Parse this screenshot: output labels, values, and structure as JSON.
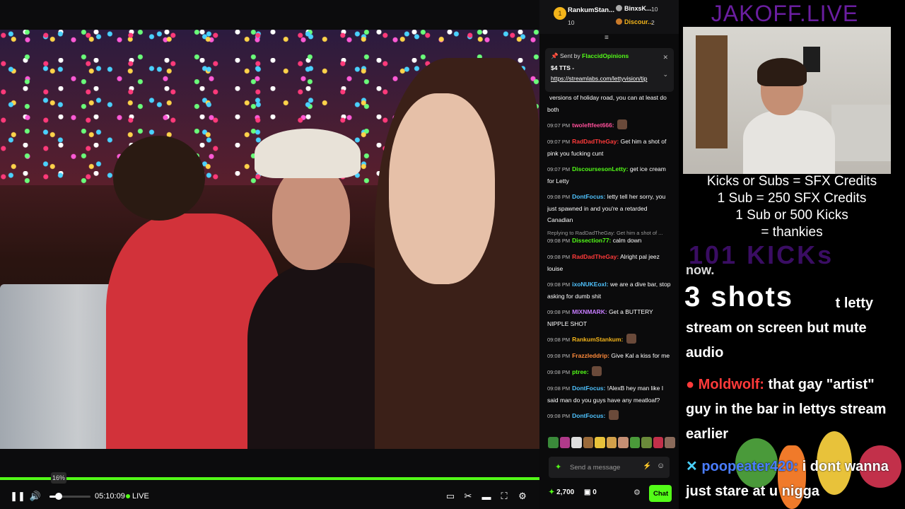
{
  "player": {
    "time": "05:10:09",
    "live_label": "LIVE",
    "volume_tooltip": "16%",
    "volume_percent": 16
  },
  "leaderboard": {
    "first": {
      "rank": "1",
      "name": "RankumStan...",
      "count": "10"
    },
    "second": {
      "name": "BinxsK...",
      "count": "10"
    },
    "third": {
      "name": "Discour...",
      "count": "2"
    }
  },
  "pinned": {
    "sent_by_label": "Sent by",
    "sender": "FlaccidOpinions",
    "amount": "$4 TTS -",
    "link": "https://streamlabs.com/lettyvision/tip"
  },
  "chat": {
    "messages": [
      {
        "time": "",
        "user": "",
        "color": "#ffffff",
        "text": "versions of holiday road, you can at least do both"
      },
      {
        "time": "09:07 PM",
        "user": "twoleftfeet666:",
        "color": "#ff4f9a",
        "text": ""
      },
      {
        "time": "09:07 PM",
        "user": "RadDadTheGay:",
        "color": "#ff3a3a",
        "text": "Get him a shot of pink you fucking cunt"
      },
      {
        "time": "09:07 PM",
        "user": "DiscoursesonLetty:",
        "color": "#53fc18",
        "text": "get ice cream for Letty"
      },
      {
        "time": "09:08 PM",
        "user": "DontFocus:",
        "color": "#4fc3ff",
        "text": "letty tell her sorry, you just spawned in and you're a retarded Canadian"
      },
      {
        "time": "09:08 PM",
        "user": "Dissection77:",
        "color": "#53fc18",
        "text": "calm down",
        "reply": "Replying to RadDadTheGay: Get him a shot of ..."
      },
      {
        "time": "09:08 PM",
        "user": "RadDadTheGay:",
        "color": "#ff3a3a",
        "text": "Alright pal jeez louise"
      },
      {
        "time": "09:08 PM",
        "user": "ixoNUKEoxl:",
        "color": "#4fc3ff",
        "text": "we are a dive bar, stop asking for dumb shit"
      },
      {
        "time": "09:08 PM",
        "user": "MIXNMARK:",
        "color": "#c77dff",
        "text": "Get a BUTTERY NIPPLE SHOT"
      },
      {
        "time": "09:08 PM",
        "user": "RankumStankum:",
        "color": "#f3b41a",
        "text": ""
      },
      {
        "time": "09:08 PM",
        "user": "Frazzleddrip:",
        "color": "#ff8a3a",
        "text": "Give Kal a kiss for me"
      },
      {
        "time": "09:08 PM",
        "user": "ptree:",
        "color": "#53fc18",
        "text": ""
      },
      {
        "time": "09:08 PM",
        "user": "DontFocus:",
        "color": "#4fc3ff",
        "text": "!AlexB hey man like I said man do you guys have any meatloaf?"
      },
      {
        "time": "09:08 PM",
        "user": "DontFocus:",
        "color": "#4fc3ff",
        "text": ""
      }
    ],
    "input_placeholder": "Send a message",
    "kicks": "2,700",
    "chest": "0",
    "chat_button": "Chat"
  },
  "overlay": {
    "title": "JAKOFF.LIVE",
    "rules": [
      "Kicks or Subs = SFX Credits",
      "1 Sub = 250 SFX Credits",
      "1 Sub or 500 Kicks",
      "= thankies"
    ],
    "kick_counter": "101 KICKs",
    "tts_partial": "now.",
    "shots": "3 shots",
    "tts_line1": "t letty",
    "tts_line2": "stream on screen but mute",
    "tts_line3": "audio",
    "msg1_user": "Moldwolf:",
    "msg1_text": " that gay \"artist\" guy in the bar in lettys stream earlier",
    "msg2_user": "poopeater420:",
    "msg2_text": " i dont wanna just stare at u nigga"
  },
  "colors": {
    "accent": "#53fc18",
    "title_purple": "#6a1ea0"
  }
}
